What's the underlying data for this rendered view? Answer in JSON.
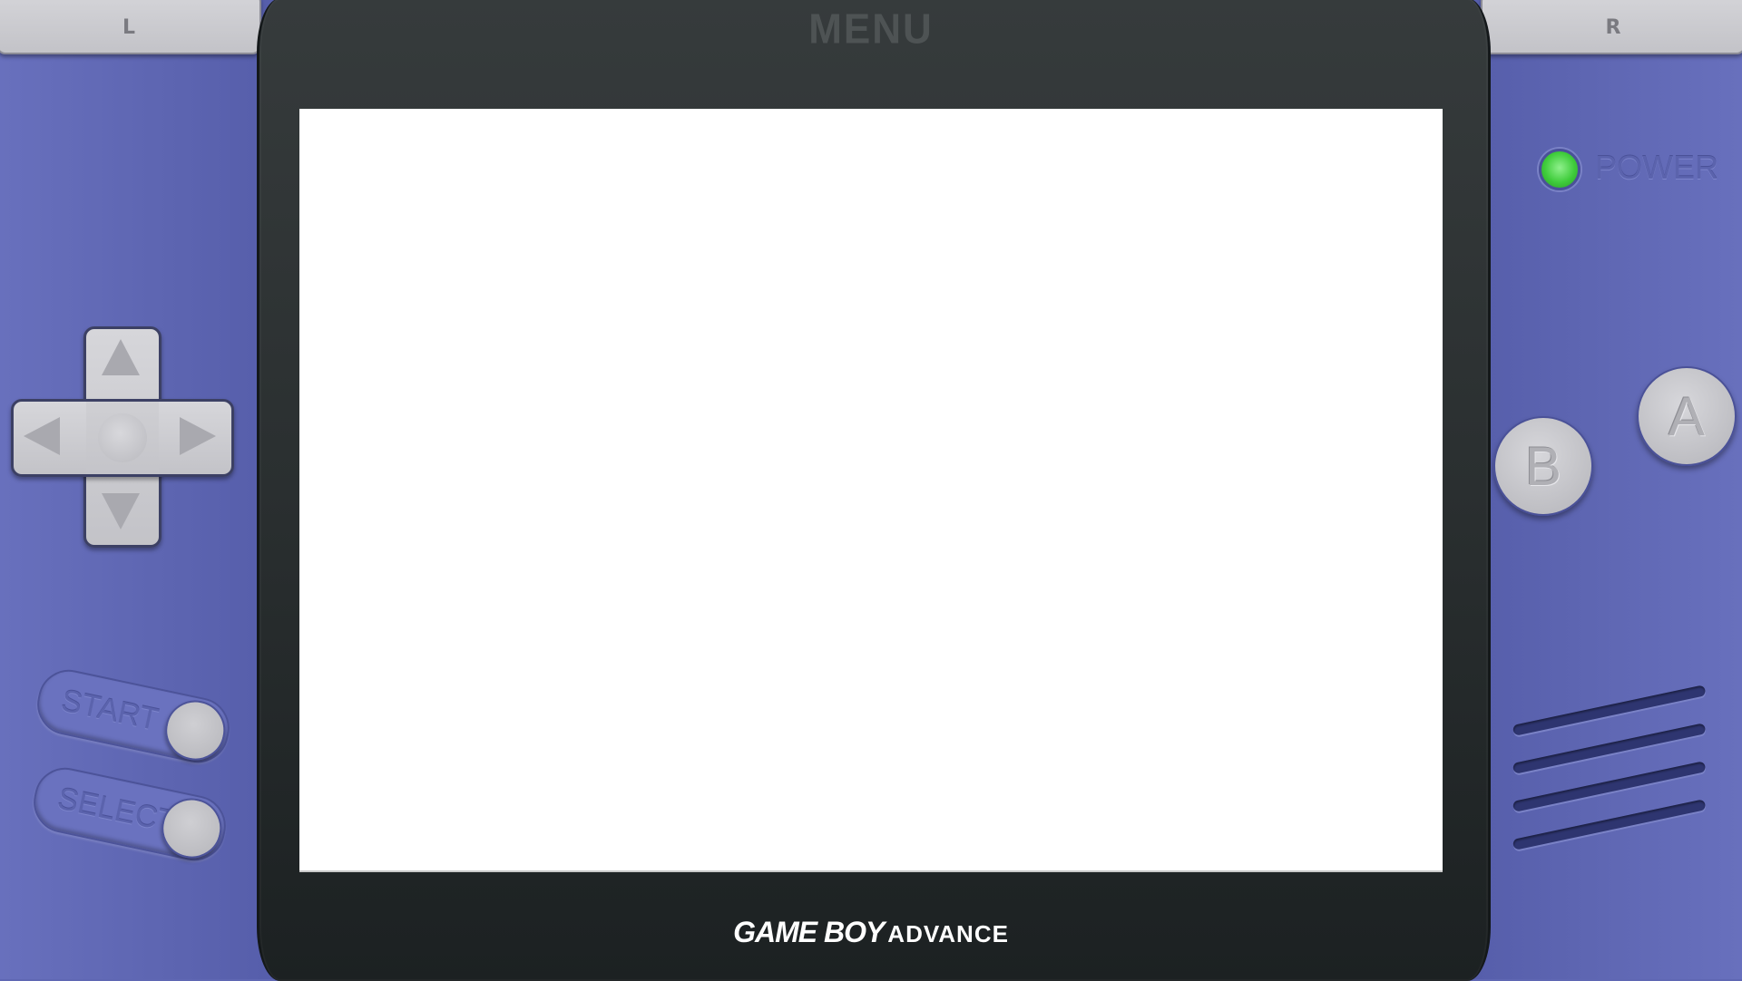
{
  "top": {
    "shoulder_left": "L",
    "shoulder_right": "R",
    "menu_label": "MENU"
  },
  "screen": {
    "background": "#ffffff"
  },
  "branding": {
    "game_boy": "GAME BOY",
    "advance": "ADVANCE"
  },
  "controls": {
    "dpad_icon": "dpad-icon",
    "start_label": "START",
    "select_label": "SELECT",
    "a_label": "A",
    "b_label": "B",
    "power_label": "POWER"
  },
  "colors": {
    "shell": "#5f67b3",
    "bezel": "#2a2f30",
    "power_led": "#3fcc3b",
    "buttons": "#c3c3c8"
  }
}
